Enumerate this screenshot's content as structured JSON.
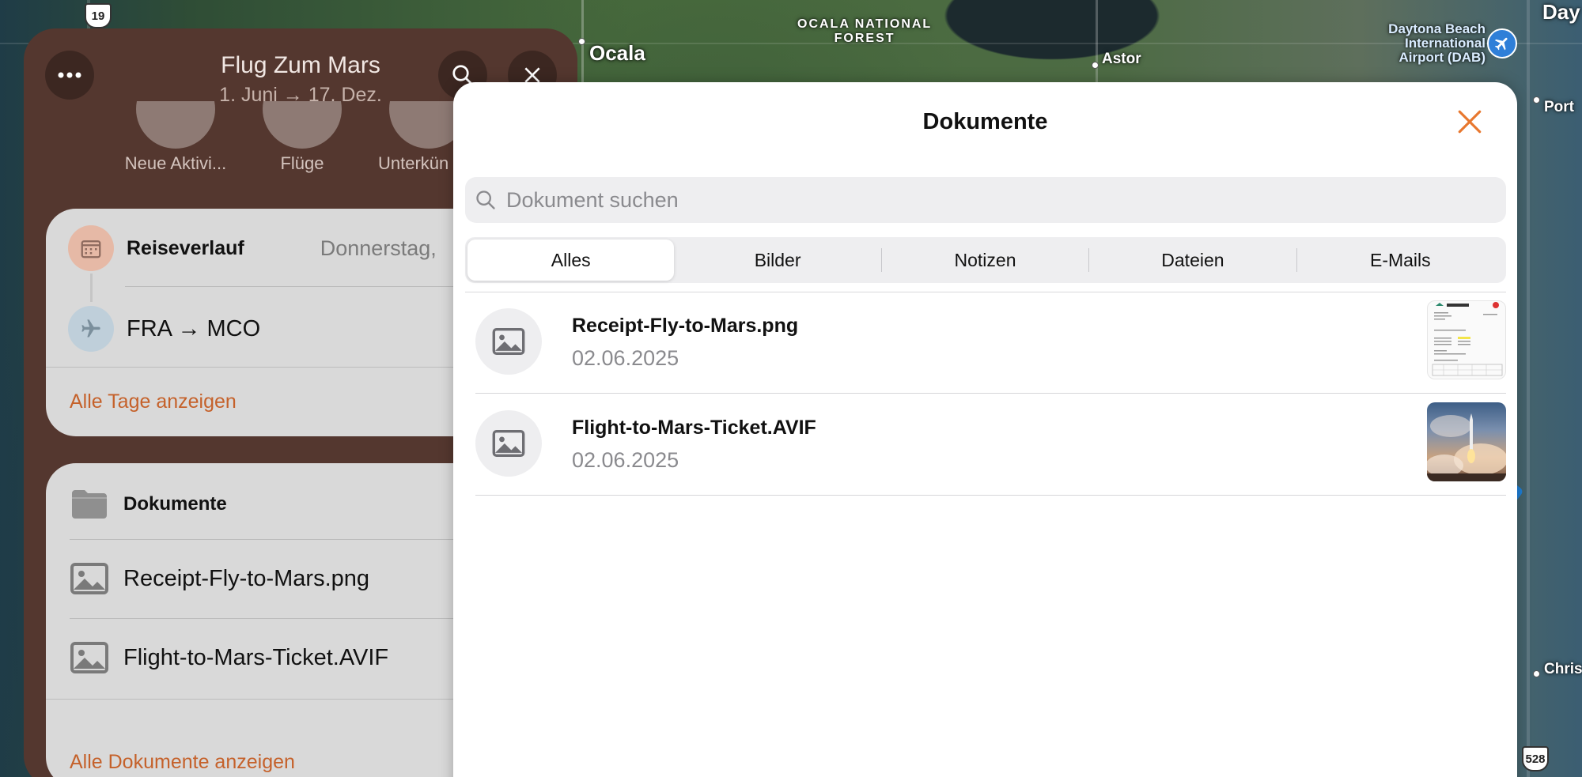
{
  "map": {
    "labels": {
      "forest": "OCALA NATIONAL\nFOREST",
      "ocala": "Ocala",
      "astor": "Astor",
      "airport": "Daytona Beach\nInternational\nAirport (DAB)",
      "daytona": "Day",
      "port": "Port",
      "chris": "Chris"
    },
    "shields": {
      "us19": "19",
      "sr528": "528"
    }
  },
  "trip": {
    "title": "Flug Zum Mars",
    "dates": "1. Juni → 17. Dez.",
    "actions": [
      {
        "label": "Neue Aktivi..."
      },
      {
        "label": "Flüge"
      },
      {
        "label": "Unterkün"
      }
    ],
    "itinerary": {
      "heading": "Reiseverlauf",
      "day": "Donnerstag,",
      "flight": "FRA → MCO",
      "link": "Alle Tage anzeigen"
    },
    "documents": {
      "heading": "Dokumente",
      "items": [
        {
          "name": "Receipt-Fly-to-Mars.png"
        },
        {
          "name": "Flight-to-Mars-Ticket.AVIF"
        }
      ],
      "link": "Alle Dokumente anzeigen"
    }
  },
  "sheet": {
    "title": "Dokumente",
    "search_placeholder": "Dokument suchen",
    "tabs": [
      "Alles",
      "Bilder",
      "Notizen",
      "Dateien",
      "E-Mails"
    ],
    "active_tab": "Alles",
    "files": [
      {
        "name": "Receipt-Fly-to-Mars.png",
        "date": "02.06.2025",
        "thumb": "receipt-thumbnail"
      },
      {
        "name": "Flight-to-Mars-Ticket.AVIF",
        "date": "02.06.2025",
        "thumb": "rocket-launch-thumbnail"
      }
    ]
  },
  "colors": {
    "accent_orange": "#e8772e",
    "link_orange": "#c5612a",
    "panel_brown": "#54372f"
  }
}
